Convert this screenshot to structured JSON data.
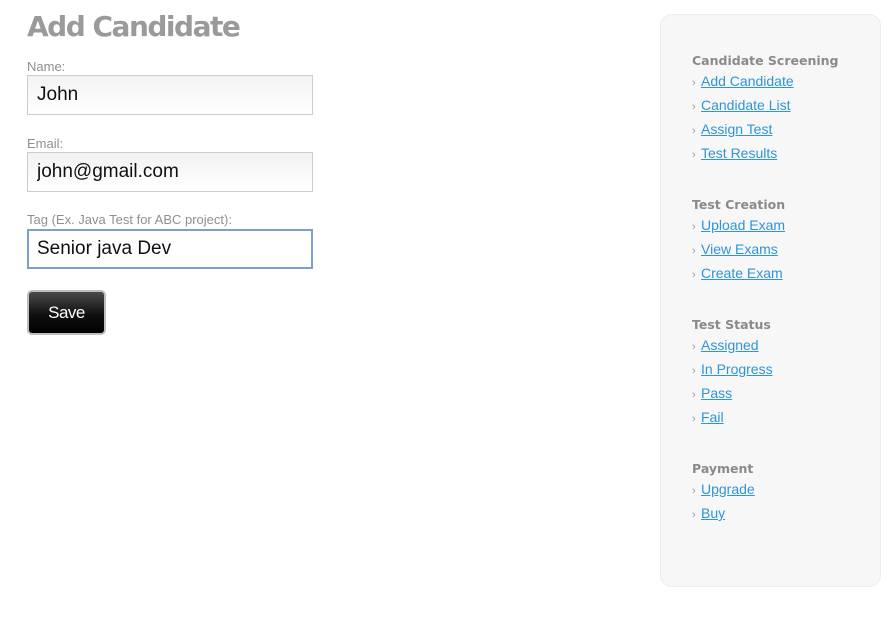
{
  "page": {
    "title": "Add Candidate"
  },
  "form": {
    "name_label": "Name:",
    "name_value": "John",
    "email_label": "Email:",
    "email_value": "john@gmail.com",
    "tag_label": "Tag (Ex. Java Test for ABC project):",
    "tag_value": "Senior java Dev",
    "save_label": "Save"
  },
  "sidebar": {
    "sections": [
      {
        "title": "Candidate Screening",
        "items": [
          "Add Candidate",
          "Candidate List",
          "Assign Test",
          "Test Results"
        ]
      },
      {
        "title": "Test Creation",
        "items": [
          "Upload Exam",
          "View Exams",
          "Create Exam"
        ]
      },
      {
        "title": "Test Status",
        "items": [
          "Assigned",
          "In Progress",
          "Pass",
          "Fail"
        ]
      },
      {
        "title": "Payment",
        "items": [
          "Upgrade",
          "Buy"
        ]
      }
    ]
  },
  "icons": {
    "chevron": "chevron-right-icon"
  },
  "colors": {
    "link": "#2f94d8",
    "title": "#9a9a9a",
    "focus_border": "#7d9ed1",
    "button": "#000000"
  }
}
